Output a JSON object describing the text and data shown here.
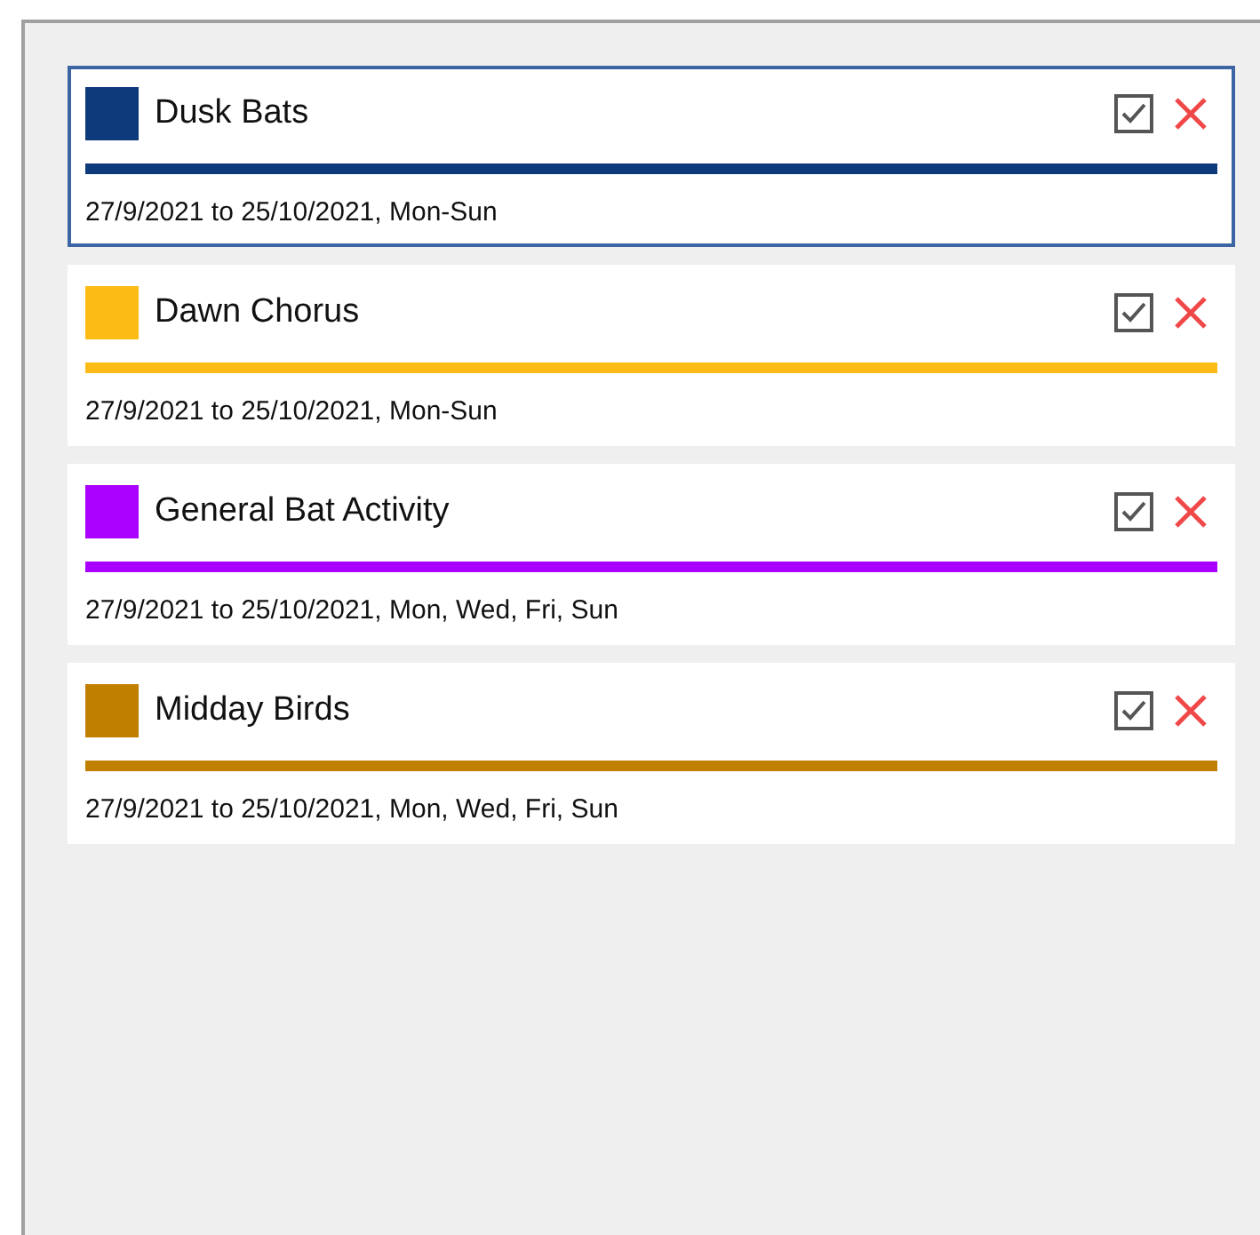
{
  "schedules": [
    {
      "name": "Dusk Bats",
      "color": "#0e3a7c",
      "dates": "27/9/2021 to 25/10/2021, Mon-Sun",
      "checked": true,
      "selected": true
    },
    {
      "name": "Dawn Chorus",
      "color": "#fdbb16",
      "dates": "27/9/2021 to 25/10/2021, Mon-Sun",
      "checked": true,
      "selected": false
    },
    {
      "name": "General Bat Activity",
      "color": "#aa00ff",
      "dates": "27/9/2021 to 25/10/2021, Mon, Wed, Fri, Sun",
      "checked": true,
      "selected": false
    },
    {
      "name": "Midday Birds",
      "color": "#c17f00",
      "dates": "27/9/2021 to 25/10/2021, Mon, Wed, Fri, Sun",
      "checked": true,
      "selected": false
    }
  ]
}
